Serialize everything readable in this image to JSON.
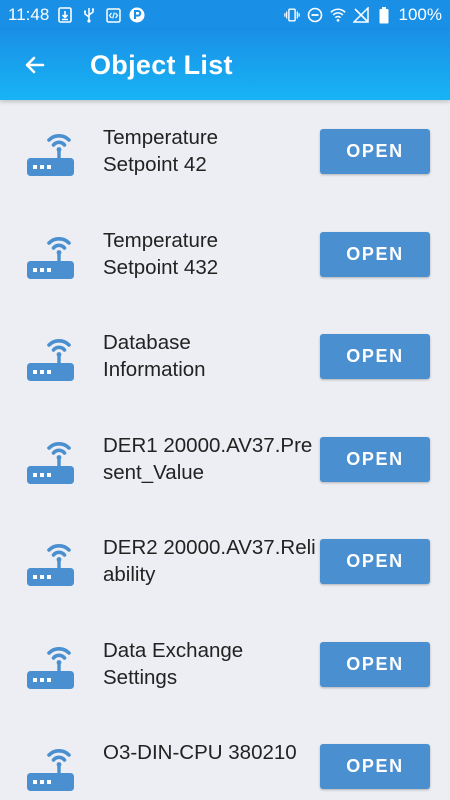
{
  "status_bar": {
    "time": "11:48",
    "battery": "100%",
    "icons": [
      "download-icon",
      "usb-icon",
      "code-icon",
      "parking-icon",
      "vibrate-icon",
      "do-not-disturb-icon",
      "wifi-icon",
      "no-signal-icon",
      "battery-icon"
    ]
  },
  "header": {
    "back_icon": "arrow-left-icon",
    "title": "Object List"
  },
  "colors": {
    "status_bar": "#1a8fe6",
    "app_bar_top": "#1a8fe6",
    "app_bar_bottom": "#17b4f5",
    "background": "#eceef3",
    "icon": "#4a8fd0",
    "button": "#4a8fd0"
  },
  "items": [
    {
      "label": "Temperature\nSetpoint 42",
      "button": "OPEN",
      "icon": "router-icon"
    },
    {
      "label": "Temperature\nSetpoint 432",
      "button": "OPEN",
      "icon": "router-icon"
    },
    {
      "label": "Database\nInformation",
      "button": "OPEN",
      "icon": "router-icon"
    },
    {
      "label": "DER1  20000.AV37.Present_Value",
      "button": "OPEN",
      "icon": "router-icon"
    },
    {
      "label": "DER2  20000.AV37.Reliability",
      "button": "OPEN",
      "icon": "router-icon"
    },
    {
      "label": "Data Exchange\nSettings",
      "button": "OPEN",
      "icon": "router-icon"
    },
    {
      "label": "O3-DIN-CPU 380210",
      "button": "OPEN",
      "icon": "router-icon"
    }
  ]
}
